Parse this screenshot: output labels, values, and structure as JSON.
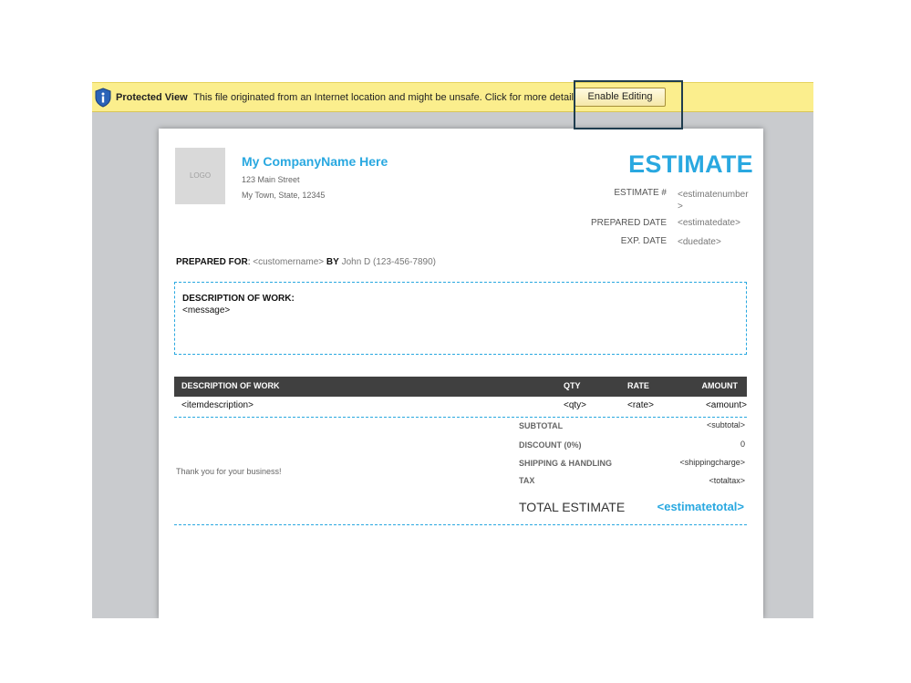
{
  "protected_view": {
    "title": "Protected View",
    "message": "This file originated from an Internet location and might be unsafe. Click for more details.",
    "button_label": "Enable Editing"
  },
  "company": {
    "logo_text": "LOGO",
    "name": "My CompanyName Here",
    "address_line1": "123 Main Street",
    "address_line2": "My Town, State, 12345"
  },
  "estimate": {
    "title": "ESTIMATE",
    "number_label": "ESTIMATE #",
    "number_value": "<estimatenumber\n>",
    "prepared_date_label": "PREPARED DATE",
    "prepared_date_value": "<estimatedate>",
    "exp_date_label": "EXP. DATE",
    "exp_date_value": "<duedate>"
  },
  "prepared_for": {
    "label": "PREPARED FOR",
    "colon": ":",
    "customer": "<customername>",
    "by_label": "BY",
    "by_value": "John D (123-456-7890)"
  },
  "description_box": {
    "heading": "DESCRIPTION OF WORK:",
    "message": "<message>"
  },
  "table": {
    "headers": [
      "DESCRIPTION OF WORK",
      "QTY",
      "RATE",
      "AMOUNT"
    ],
    "row": [
      "<itemdescription>",
      "<qty>",
      "<rate>",
      "<amount>"
    ]
  },
  "totals": {
    "thanks": "Thank you for your business!",
    "subtotal_label": "SUBTOTAL",
    "subtotal_value": "<subtotal>",
    "discount_label": "DISCOUNT (0%)",
    "discount_value": "0",
    "shipping_label": "SHIPPING & HANDLING",
    "shipping_value": "<shippingcharge>",
    "tax_label": "TAX",
    "tax_value": "<totaltax>",
    "total_label": "TOTAL ESTIMATE",
    "total_value": "<estimatetotal>"
  },
  "colors": {
    "accent": "#29a8e0",
    "banner": "#fbee8d",
    "header_bg": "#404040"
  }
}
